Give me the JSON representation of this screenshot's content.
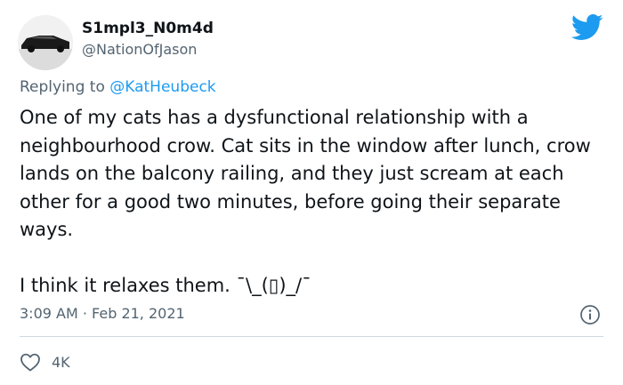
{
  "user": {
    "display_name": "S1mpl3_N0m4d",
    "handle": "@NationOfJason",
    "avatar": "car-avatar"
  },
  "icons": {
    "brand": "twitter-bird-icon",
    "info": "info-icon",
    "like": "heart-icon"
  },
  "colors": {
    "brand_blue": "#1d9bf0",
    "text": "#0f1419",
    "secondary": "#536471",
    "divider": "#cfd9de"
  },
  "tweet": {
    "reply_prefix": "Replying to",
    "reply_to": "@KatHeubeck",
    "paragraph_1": "One of my cats has a dysfunctional relationship with a neighbourhood crow. Cat sits in the window after lunch, crow lands on the balcony railing, and they just scream at each other for a good two minutes, before going their separate ways.",
    "paragraph_2": "I think it relaxes them. ¯\\_(▯)_/¯",
    "timestamp": "3:09 AM · Feb 21, 2021",
    "like_count": "4K"
  }
}
